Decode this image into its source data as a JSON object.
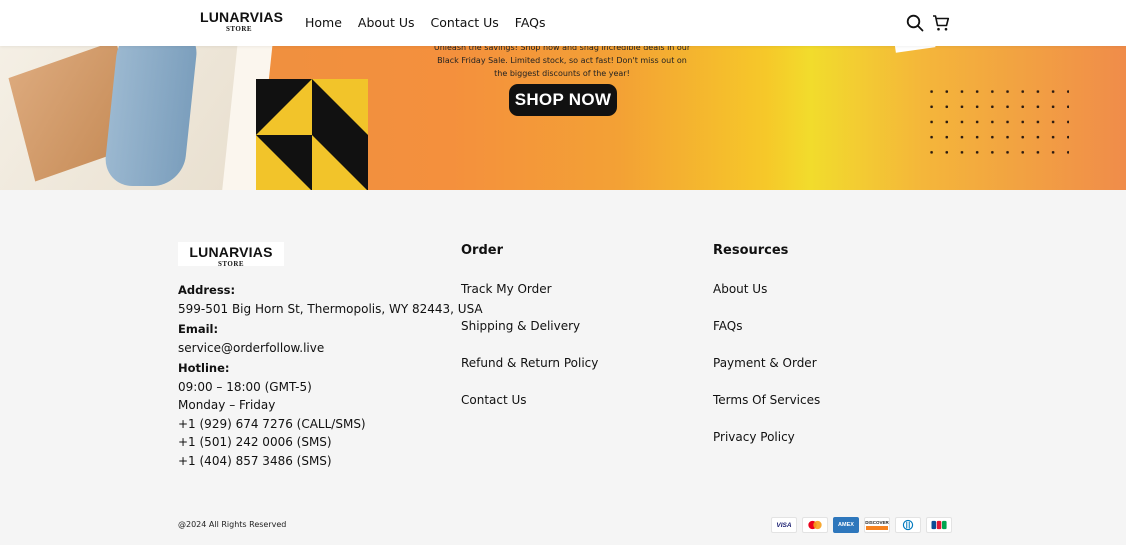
{
  "brand": {
    "name": "LUNARVIAS",
    "sub": "STORE"
  },
  "nav": [
    "Home",
    "About Us",
    "Contact Us",
    "FAQs"
  ],
  "header_icons": [
    "search-icon",
    "cart-icon"
  ],
  "banner": {
    "text_line1": "Unleash the savings! Shop now and snag incredible deals in our",
    "text_line2": "Black Friday Sale. Limited stock, so act fast! Don't miss out on",
    "text_line3": "the biggest discounts of the year!",
    "cta": "SHOP NOW"
  },
  "footer": {
    "address_label": "Address:",
    "address": "599-501 Big Horn St, Thermopolis, WY 82443, USA",
    "email_label": "Email:",
    "email": "service@orderfollow.live",
    "hotline_label": "Hotline:",
    "hotline_lines": [
      "09:00 – 18:00 (GMT-5)",
      "Monday – Friday",
      "+1 (929) 674 7276 (CALL/SMS)",
      "+1 (501) 242 0006 (SMS)",
      "+1 (404) 857 3486 (SMS)"
    ],
    "order_title": "Order",
    "order_links": [
      "Track My Order",
      "Shipping & Delivery",
      "Refund & Return Policy",
      "Contact Us"
    ],
    "resources_title": "Resources",
    "resources_links": [
      "About Us",
      "FAQs",
      "Payment & Order",
      "Terms Of Services",
      "Privacy Policy"
    ],
    "copyright": "@2024 All Rights Reserved",
    "payments": [
      "VISA",
      "mastercard",
      "AMEX",
      "DISCOVER",
      "diners",
      "JCB"
    ]
  },
  "colors": {
    "cta_bg": "#111111",
    "banner_orange": "#f0903f",
    "banner_yellow": "#f2dc2c"
  }
}
